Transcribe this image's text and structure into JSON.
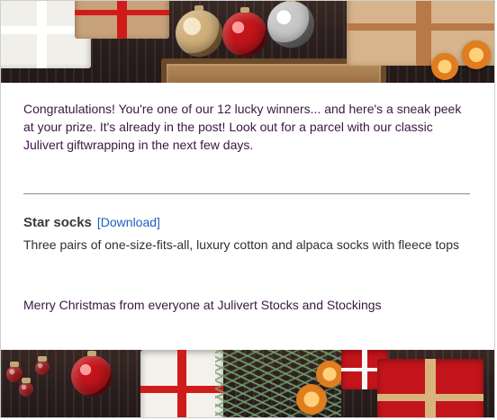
{
  "email": {
    "intro_text": "Congratulations! You're one of our 12 lucky winners... and here's a sneak peek at your prize. It's already in the post! Look out for a parcel with our classic Julivert giftwrapping in the next few days.",
    "prize": {
      "title": "Star socks",
      "download_label": "[Download]",
      "description": "Three pairs of one-size-fits-all, luxury cotton and alpaca socks with fleece tops"
    },
    "signoff": "Merry Christmas from everyone at Julivert Stocks and Stockings"
  },
  "colors": {
    "text_purple": "#3b1744",
    "link_blue": "#1f5fbf",
    "divider_gray": "#8b8b8b"
  },
  "icons": {
    "top_banner": "christmas-gifts-and-ornaments",
    "bottom_banner": "christmas-gifts-and-decorations"
  }
}
